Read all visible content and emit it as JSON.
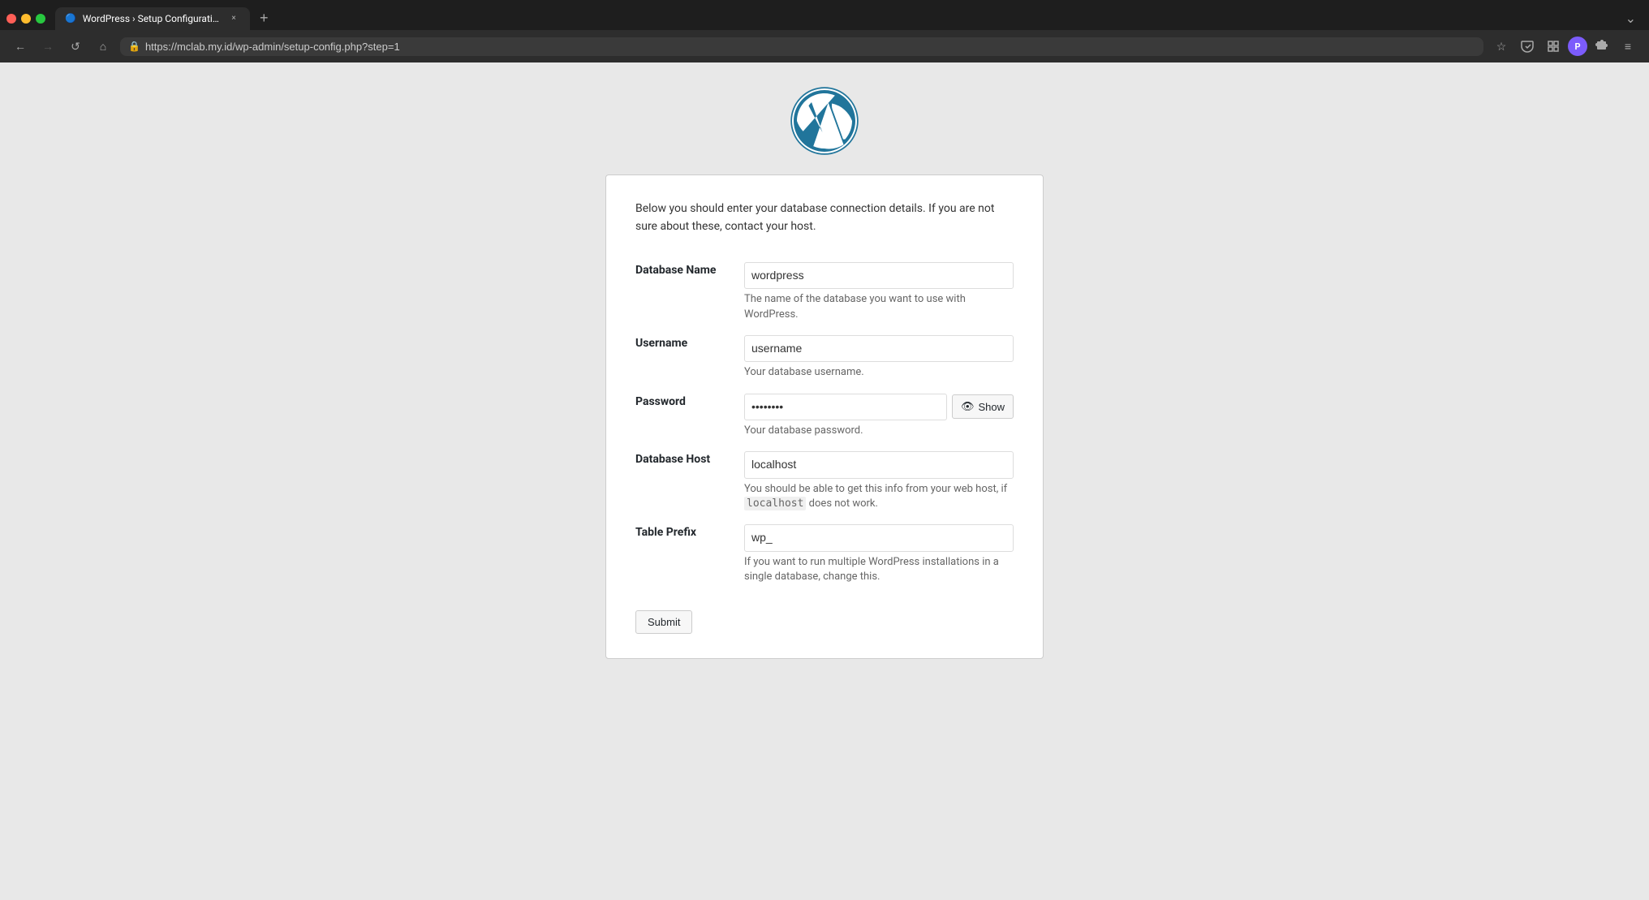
{
  "browser": {
    "tab_title": "WordPress › Setup Configuration Fi…",
    "tab_close": "×",
    "new_tab": "+",
    "overflow": "⌄",
    "url": "https://mclab.my.id/wp-admin/setup-config.php?step=1",
    "nav": {
      "back": "←",
      "forward": "→",
      "reload": "↺",
      "home": "⌂"
    },
    "actions": {
      "bookmark": "☆",
      "pocket": "",
      "container": "",
      "profile": "",
      "extensions": "",
      "menu": "≡"
    }
  },
  "page": {
    "intro": "Below you should enter your database connection details. If you are not sure about these, contact your host.",
    "fields": [
      {
        "label": "Database Name",
        "value": "wordpress",
        "desc": "The name of the database you want to use with WordPress.",
        "type": "text",
        "id": "dbname"
      },
      {
        "label": "Username",
        "value": "username",
        "desc": "Your database username.",
        "type": "text",
        "id": "uname"
      },
      {
        "label": "Password",
        "value": "password",
        "desc": "Your database password.",
        "type": "password",
        "id": "pwd"
      },
      {
        "label": "Database Host",
        "value": "localhost",
        "desc_prefix": "You should be able to get this info from your web host, if ",
        "desc_code": "localhost",
        "desc_suffix": " does not work.",
        "type": "text",
        "id": "dbhost"
      },
      {
        "label": "Table Prefix",
        "value": "wp_",
        "desc": "If you want to run multiple WordPress installations in a single database, change this.",
        "type": "text",
        "id": "prefix"
      }
    ],
    "show_button_label": "Show",
    "submit_label": "Submit"
  }
}
